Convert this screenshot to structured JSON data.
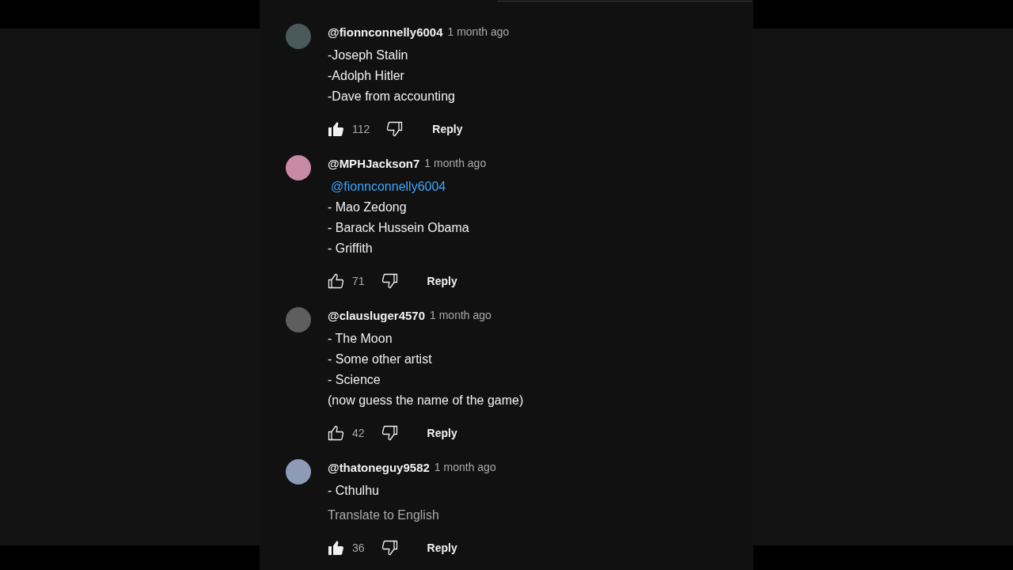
{
  "comments": [
    {
      "author": "@fionnconnelly6004",
      "time": "1 month ago",
      "lines": [
        {
          "kind": "text",
          "text": "-Joseph Stalin"
        },
        {
          "kind": "text",
          "text": "-Adolph Hitler"
        },
        {
          "kind": "text",
          "text": "-Dave from accounting"
        }
      ],
      "liked": true,
      "likes": "112",
      "reply": "Reply"
    },
    {
      "author": "@MPHJackson7",
      "time": "1 month ago",
      "lines": [
        {
          "kind": "mention",
          "text": "@fionnconnelly6004"
        },
        {
          "kind": "text",
          "text": "- Mao Zedong"
        },
        {
          "kind": "text",
          "text": "- Barack Hussein Obama"
        },
        {
          "kind": "text",
          "text": "- Griffith"
        }
      ],
      "liked": false,
      "likes": "71",
      "reply": "Reply"
    },
    {
      "author": "@clausluger4570",
      "time": "1 month ago",
      "lines": [
        {
          "kind": "text",
          "text": "- The Moon"
        },
        {
          "kind": "text",
          "text": "- Some other artist"
        },
        {
          "kind": "text",
          "text": "- Science"
        },
        {
          "kind": "text",
          "text": "(now guess the name of the game)"
        }
      ],
      "liked": false,
      "likes": "42",
      "reply": "Reply"
    },
    {
      "author": "@thatoneguy9582",
      "time": "1 month ago",
      "lines": [
        {
          "kind": "text",
          "text": "- Cthulhu"
        }
      ],
      "translate": "Translate to English",
      "liked": true,
      "likes": "36",
      "reply": "Reply"
    }
  ]
}
